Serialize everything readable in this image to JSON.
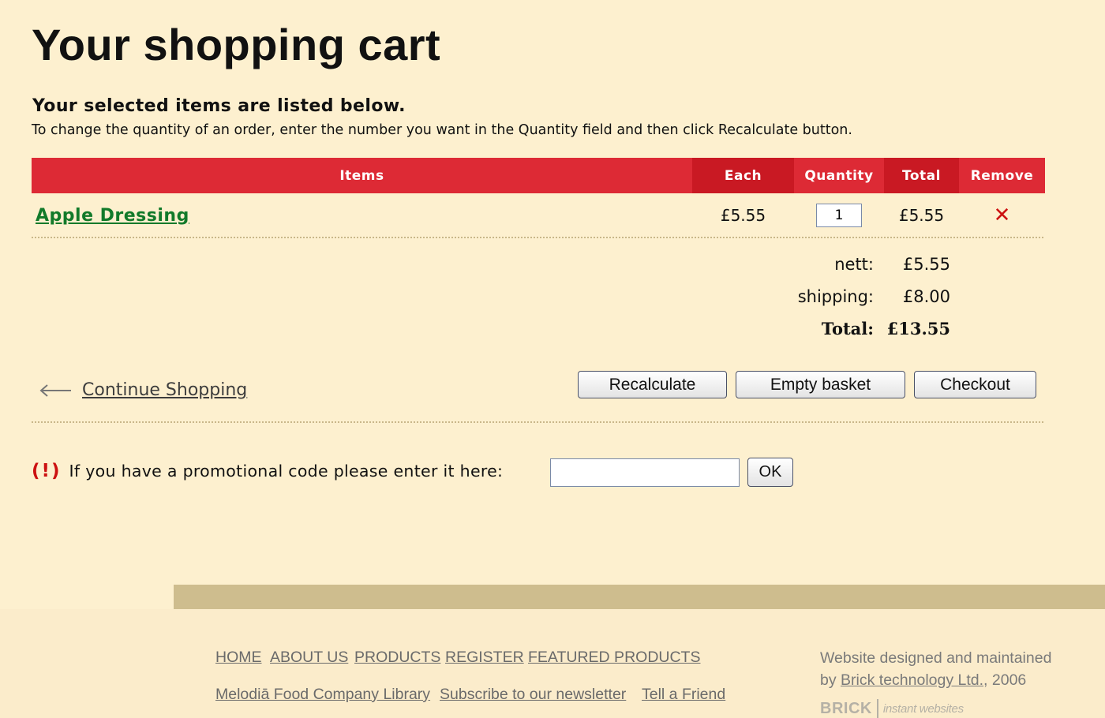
{
  "header": {
    "title": "Your shopping cart",
    "subtitle": "Your selected items are listed below.",
    "instructions": "To change the quantity of an order, enter the number you want in the Quantity field and then click Recalculate button."
  },
  "cart": {
    "columns": [
      "Items",
      "Each",
      "Quantity",
      "Total",
      "Remove"
    ],
    "items": [
      {
        "name": "Apple Dressing",
        "each": "£5.55",
        "quantity": "1",
        "total": "£5.55",
        "remove_icon": "close-icon"
      }
    ]
  },
  "summary": {
    "nett_label": "nett:",
    "nett_value": "£5.55",
    "shipping_label": "shipping:",
    "shipping_value": "£8.00",
    "total_label": "Total:",
    "total_value": "£13.55"
  },
  "actions": {
    "continue_label": "Continue Shopping",
    "recalculate_label": "Recalculate",
    "empty_label": "Empty basket",
    "checkout_label": "Checkout"
  },
  "promo": {
    "alert_icon": "(!)",
    "label": "If you have a promotional code please enter it here:",
    "value": "",
    "ok_label": "OK"
  },
  "footer": {
    "nav": [
      "HOME",
      "ABOUT US",
      "PRODUCTS",
      "REGISTER",
      "FEATURED PRODUCTS"
    ],
    "links": [
      "Melodiā Food Company Library",
      "Subscribe to our newsletter",
      "Tell a Friend"
    ],
    "credit_line1": "Website designed and maintained",
    "credit_by": "by",
    "credit_company": "Brick technology Ltd.",
    "credit_year": ", 2006",
    "logo_brand": "BRICK",
    "logo_tagline": "instant websites"
  },
  "colors": {
    "accent": "#dd2a35",
    "accent_dark": "#c91923",
    "link_green": "#127a2a",
    "background": "#fdf0cf"
  }
}
